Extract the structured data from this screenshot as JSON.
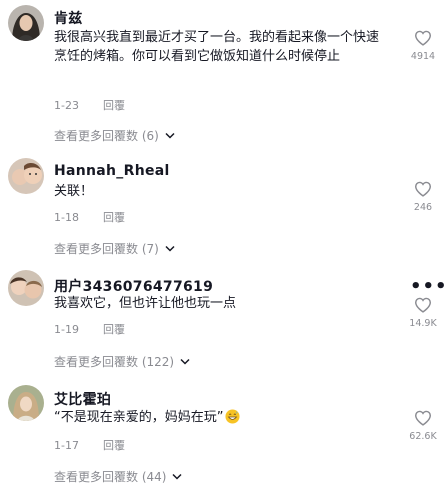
{
  "comments": [
    {
      "username": "肯兹",
      "text": "我很高兴我直到最近才买了一台。我的看起来像一个快速烹饪的烤箱。你可以看到它做饭知道什么时候停止",
      "date": "1-23",
      "reply_label": "回覆",
      "likes": "4914",
      "view_more": "查看更多回覆数 (6)",
      "avatar_icon": "profile-photo"
    },
    {
      "username": "Hannah_Rheal",
      "text": "关联！",
      "date": "1-18",
      "reply_label": "回覆",
      "likes": "246",
      "view_more": "查看更多回覆数 (7)",
      "avatar_icon": "profile-photo"
    },
    {
      "username": "用户3436076477619",
      "text": "我喜欢它，但也许让他也玩一点",
      "date": "1-19",
      "reply_label": "回覆",
      "likes": "14.9K",
      "view_more": "查看更多回覆数 (122)",
      "more_icon": "more-dots-icon",
      "avatar_icon": "profile-photo"
    },
    {
      "username": "艾比霍珀",
      "text": "“不是现在亲爱的，妈妈在玩”",
      "text_emoji": "grinning-sweat-emoji",
      "date": "1-17",
      "reply_label": "回覆",
      "likes": "62.6K",
      "view_more": "查看更多回覆数 (44)",
      "avatar_icon": "profile-photo"
    }
  ],
  "colors": {
    "text": "#161823",
    "secondary": "#8a8b91"
  }
}
